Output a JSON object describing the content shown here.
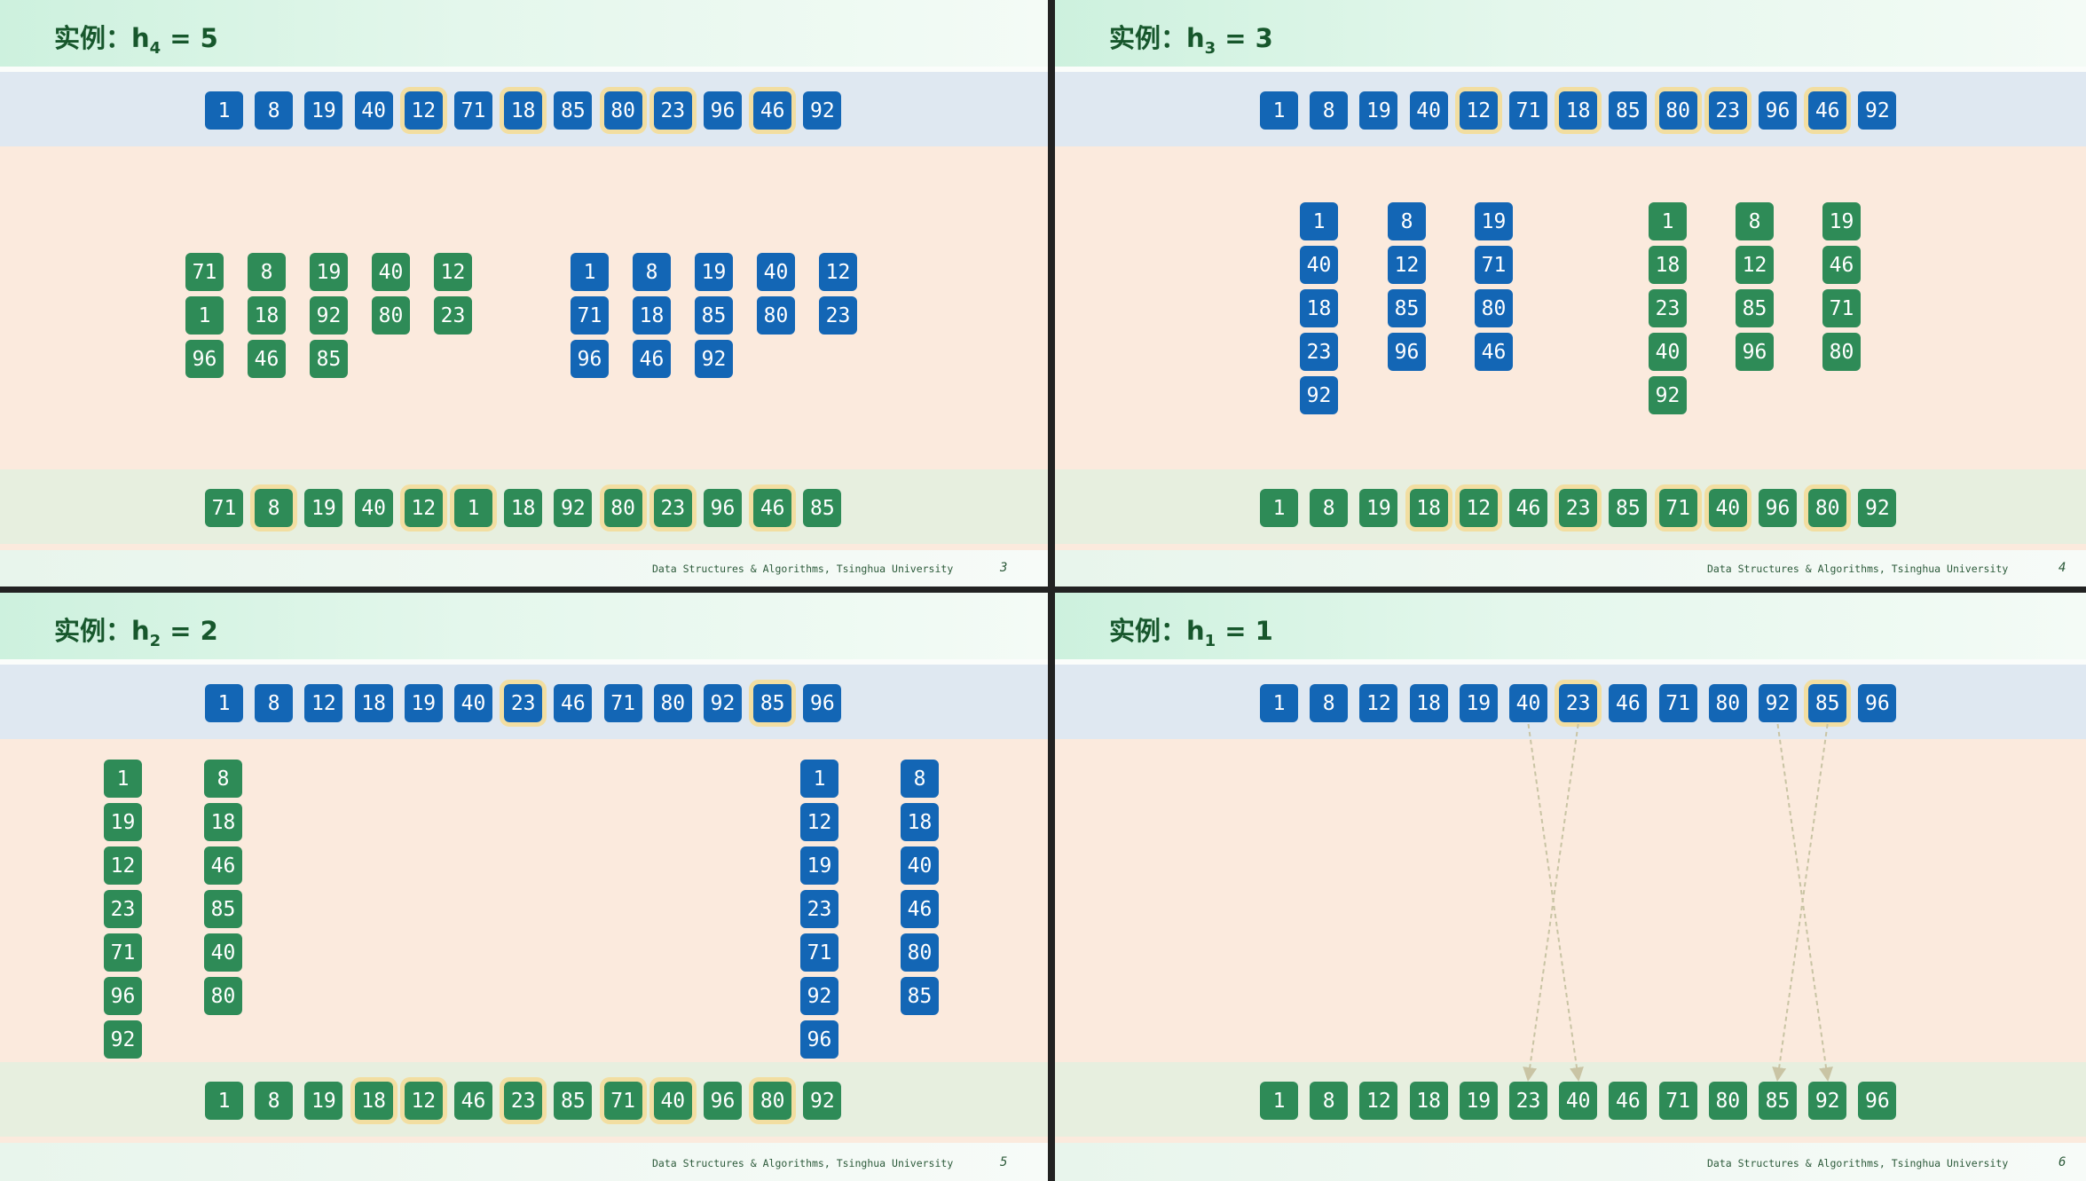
{
  "footer_text": "Data Structures & Algorithms, Tsinghua University",
  "slides": [
    {
      "title_prefix": "实例：h",
      "title_sub": "4",
      "title_suffix": " = 5",
      "page_number": "3",
      "top_row": [
        "1",
        "8",
        "19",
        "40",
        "12",
        "71",
        "18",
        "85",
        "80",
        "23",
        "96",
        "46",
        "92"
      ],
      "top_highlight": [
        4,
        6,
        8,
        9,
        11
      ],
      "groups": [
        {
          "color": "green",
          "columns": [
            [
              "71",
              "1",
              "96"
            ],
            [
              "8",
              "18",
              "46"
            ],
            [
              "19",
              "92",
              "85"
            ],
            [
              "40",
              "80"
            ],
            [
              "12",
              "23"
            ]
          ]
        },
        {
          "color": "blue",
          "columns": [
            [
              "1",
              "71",
              "96"
            ],
            [
              "8",
              "18",
              "46"
            ],
            [
              "19",
              "85",
              "92"
            ],
            [
              "40",
              "80"
            ],
            [
              "12",
              "23"
            ]
          ]
        }
      ],
      "bottom_row": [
        "71",
        "8",
        "19",
        "40",
        "12",
        "1",
        "18",
        "92",
        "80",
        "23",
        "96",
        "46",
        "85"
      ],
      "bottom_highlight": [
        1,
        4,
        5,
        8,
        9,
        11
      ]
    },
    {
      "title_prefix": "实例：h",
      "title_sub": "3",
      "title_suffix": " = 3",
      "page_number": "4",
      "top_row": [
        "1",
        "8",
        "19",
        "40",
        "12",
        "71",
        "18",
        "85",
        "80",
        "23",
        "96",
        "46",
        "92"
      ],
      "top_highlight": [
        4,
        6,
        8,
        9,
        11
      ],
      "groups": [
        {
          "color": "blue",
          "columns": [
            [
              "1",
              "40",
              "18",
              "23",
              "92"
            ],
            [
              "8",
              "12",
              "85",
              "96"
            ],
            [
              "19",
              "71",
              "80",
              "46"
            ]
          ]
        },
        {
          "color": "green",
          "columns": [
            [
              "1",
              "18",
              "23",
              "40",
              "92"
            ],
            [
              "8",
              "12",
              "85",
              "96"
            ],
            [
              "19",
              "46",
              "71",
              "80"
            ]
          ]
        }
      ],
      "bottom_row": [
        "1",
        "8",
        "19",
        "18",
        "12",
        "46",
        "23",
        "85",
        "71",
        "40",
        "96",
        "80",
        "92"
      ],
      "bottom_highlight": [
        3,
        4,
        6,
        8,
        9,
        11
      ]
    },
    {
      "title_prefix": "实例：h",
      "title_sub": "2",
      "title_suffix": " = 2",
      "page_number": "5",
      "top_row": [
        "1",
        "8",
        "12",
        "18",
        "19",
        "40",
        "23",
        "46",
        "71",
        "80",
        "92",
        "85",
        "96"
      ],
      "top_highlight": [
        6,
        11
      ],
      "groups": [
        {
          "color": "green",
          "columns": [
            [
              "1",
              "19",
              "12",
              "23",
              "71",
              "96",
              "92"
            ],
            [
              "8",
              "18",
              "46",
              "85",
              "40",
              "80"
            ]
          ]
        },
        {
          "color": "blue",
          "columns": [
            [
              "1",
              "12",
              "19",
              "23",
              "71",
              "92",
              "96"
            ],
            [
              "8",
              "18",
              "40",
              "46",
              "80",
              "85"
            ]
          ]
        }
      ],
      "bottom_row": [
        "1",
        "8",
        "19",
        "18",
        "12",
        "46",
        "23",
        "85",
        "71",
        "40",
        "96",
        "80",
        "92"
      ],
      "bottom_highlight": [
        3,
        4,
        6,
        8,
        9,
        11
      ]
    },
    {
      "title_prefix": "实例：h",
      "title_sub": "1",
      "title_suffix": " = 1",
      "page_number": "6",
      "top_row": [
        "1",
        "8",
        "12",
        "18",
        "19",
        "40",
        "23",
        "46",
        "71",
        "80",
        "92",
        "85",
        "96"
      ],
      "top_highlight": [
        6,
        11
      ],
      "groups": [],
      "bottom_row": [
        "1",
        "8",
        "12",
        "18",
        "19",
        "23",
        "40",
        "46",
        "71",
        "80",
        "85",
        "92",
        "96"
      ],
      "bottom_highlight": [],
      "swap_arrows": [
        [
          5,
          6
        ],
        [
          6,
          5
        ],
        [
          10,
          11
        ],
        [
          11,
          10
        ]
      ]
    }
  ]
}
